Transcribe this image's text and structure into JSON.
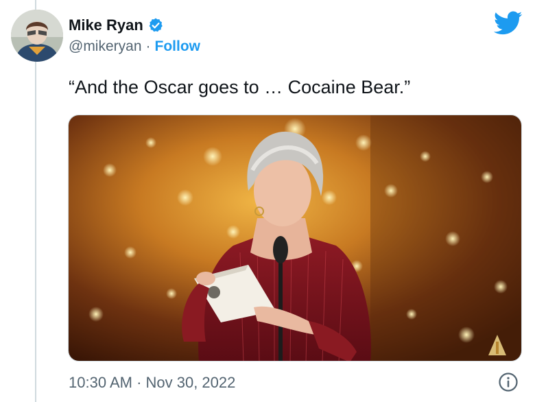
{
  "author": {
    "display_name": "Mike Ryan",
    "handle": "@mikeryan",
    "separator": "·",
    "follow_label": "Follow",
    "verified_icon": "verified-badge-icon"
  },
  "tweet": {
    "text": "“And the Oscar goes to … Cocaine Bear.”",
    "timestamp": "10:30 AM · Nov 30, 2022"
  },
  "icons": {
    "brand": "twitter-bird-icon",
    "info": "info-icon"
  },
  "colors": {
    "accent": "#1d9bf0",
    "text": "#0f1419",
    "secondary": "#536471",
    "border": "#cfd9de"
  }
}
